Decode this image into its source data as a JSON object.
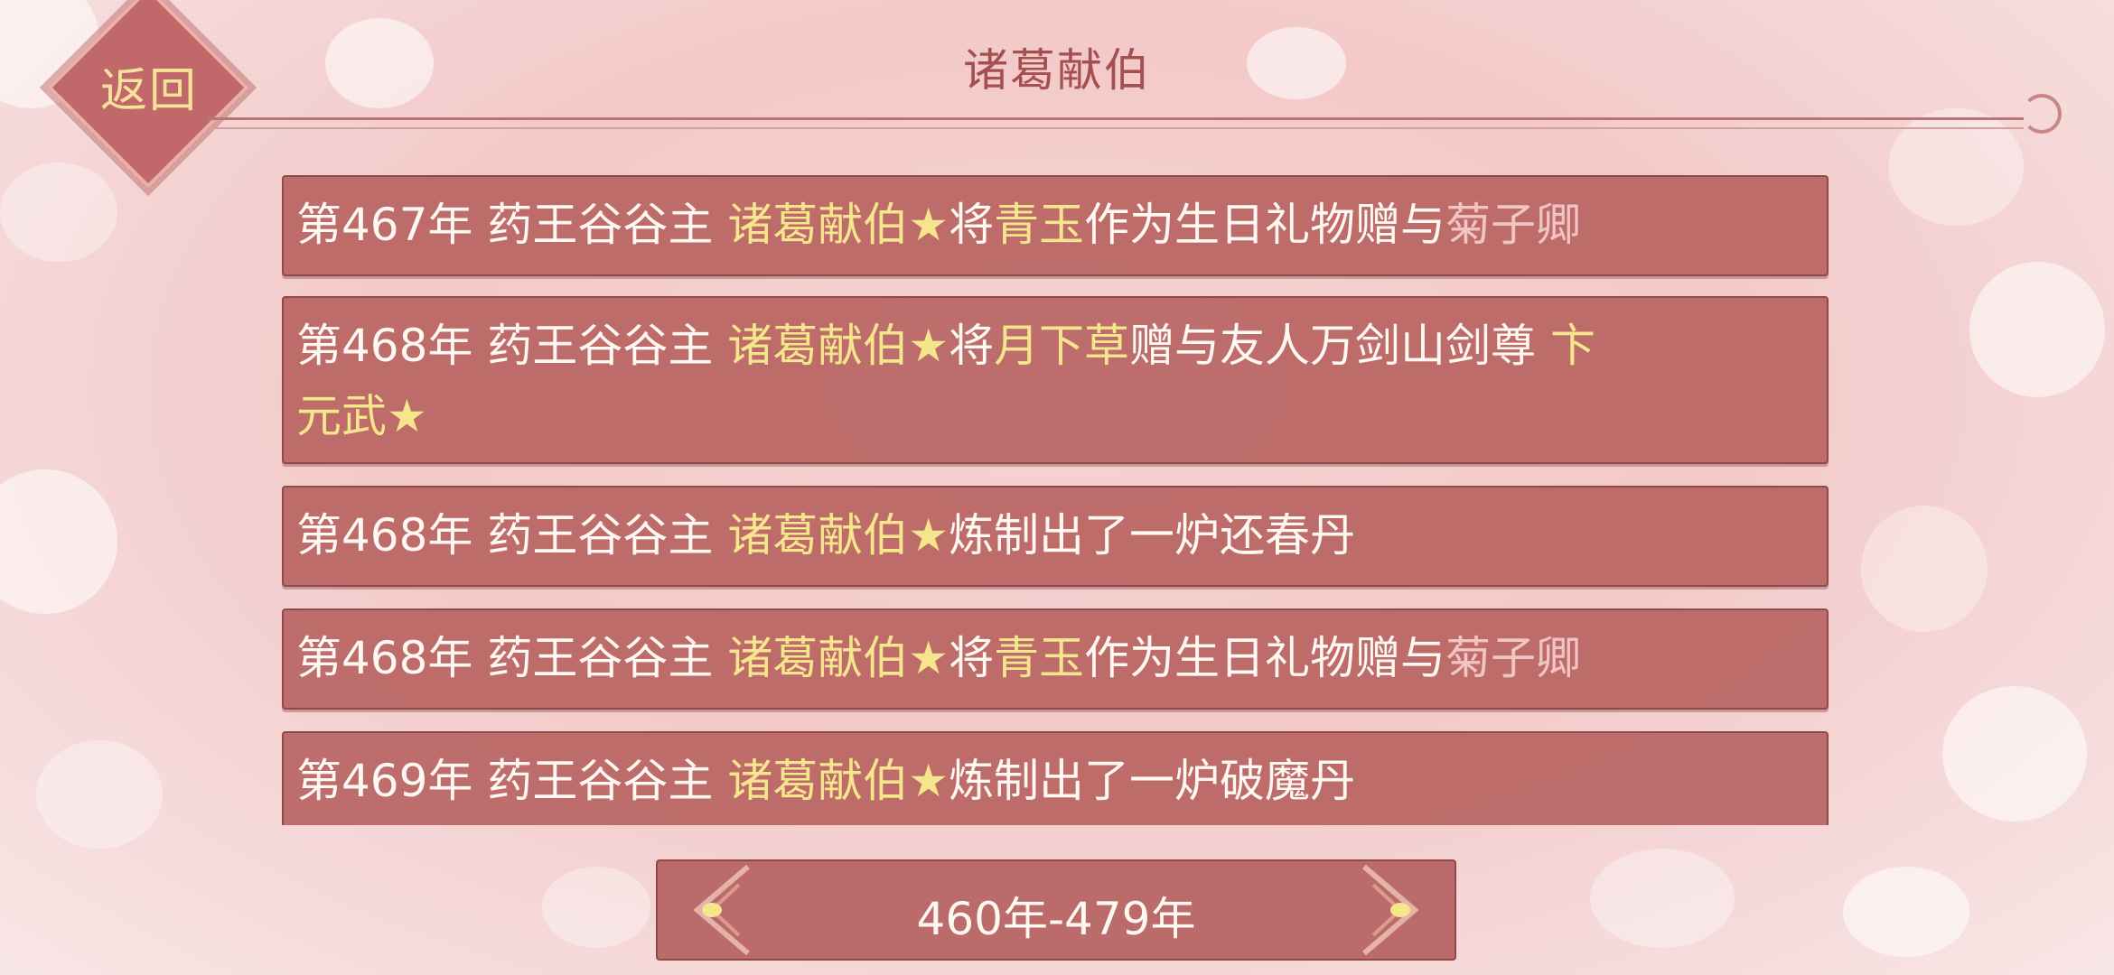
{
  "header": {
    "back_label": "返回",
    "title": "诸葛献伯"
  },
  "entries": [
    {
      "year": "第467年",
      "lines": [
        [
          {
            "t": "第467年 药王谷谷主 ",
            "c": "w"
          },
          {
            "t": "诸葛献伯",
            "c": "g"
          },
          {
            "t": "★",
            "c": "g"
          },
          {
            "t": "将",
            "c": "w"
          },
          {
            "t": "青玉",
            "c": "g"
          },
          {
            "t": "作为生日礼物赠与",
            "c": "w"
          },
          {
            "t": "菊子卿",
            "c": "p"
          }
        ]
      ]
    },
    {
      "year": "第468年",
      "lines": [
        [
          {
            "t": "第468年 药王谷谷主 ",
            "c": "w"
          },
          {
            "t": "诸葛献伯",
            "c": "g"
          },
          {
            "t": "★",
            "c": "g"
          },
          {
            "t": "将",
            "c": "w"
          },
          {
            "t": "月下草",
            "c": "g"
          },
          {
            "t": "赠与友人万剑山剑尊 ",
            "c": "w"
          },
          {
            "t": "卞",
            "c": "g"
          }
        ],
        [
          {
            "t": "元武",
            "c": "g"
          },
          {
            "t": "★",
            "c": "g"
          }
        ]
      ]
    },
    {
      "year": "第468年",
      "lines": [
        [
          {
            "t": "第468年 药王谷谷主 ",
            "c": "w"
          },
          {
            "t": "诸葛献伯",
            "c": "g"
          },
          {
            "t": "★",
            "c": "g"
          },
          {
            "t": "炼制出了一炉还春丹",
            "c": "w"
          }
        ]
      ]
    },
    {
      "year": "第468年",
      "lines": [
        [
          {
            "t": "第468年 药王谷谷主 ",
            "c": "w"
          },
          {
            "t": "诸葛献伯",
            "c": "g"
          },
          {
            "t": "★",
            "c": "g"
          },
          {
            "t": "将",
            "c": "w"
          },
          {
            "t": "青玉",
            "c": "g"
          },
          {
            "t": "作为生日礼物赠与",
            "c": "w"
          },
          {
            "t": "菊子卿",
            "c": "p"
          }
        ]
      ]
    },
    {
      "year": "第469年",
      "lines": [
        [
          {
            "t": "第469年 药王谷谷主 ",
            "c": "w"
          },
          {
            "t": "诸葛献伯",
            "c": "g"
          },
          {
            "t": "★",
            "c": "g"
          },
          {
            "t": "炼制出了一炉破魔丹",
            "c": "w"
          }
        ]
      ]
    }
  ],
  "pager": {
    "range_label": "460年-479年"
  },
  "colors": {
    "entry_bg": "#b35c5a",
    "highlight_gold": "#f5e58c",
    "highlight_pink": "#f0c5c3",
    "title": "#a55050"
  }
}
